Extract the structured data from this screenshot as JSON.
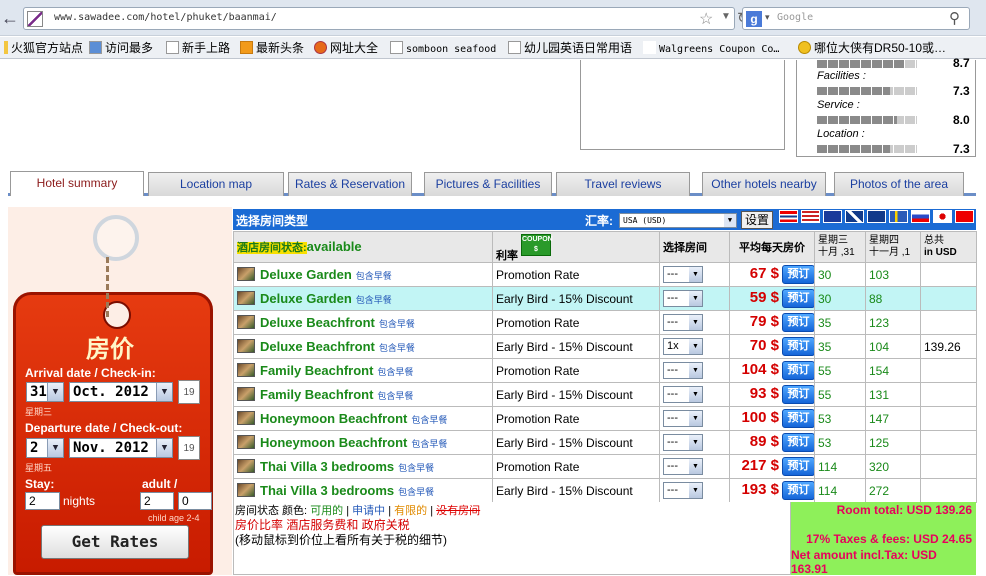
{
  "browser": {
    "url": "www.sawadee.com/hotel/phuket/baanmai/",
    "search_placeholder": "Google",
    "bookmarks": [
      "火狐官方站点",
      "访问最多",
      "新手上路",
      "最新头条",
      "网址大全",
      "somboon seafood",
      "幼儿园英语日常用语",
      "Walgreens Coupon Co…",
      "哪位大侠有DR50-10或…"
    ]
  },
  "ratings": [
    {
      "label": "",
      "value": "8.7",
      "fill": 0.87
    },
    {
      "label": "Facilities :",
      "value": "7.3",
      "fill": 0.73
    },
    {
      "label": "Service :",
      "value": "8.0",
      "fill": 0.8
    },
    {
      "label": "Location :",
      "value": "7.3",
      "fill": 0.73
    }
  ],
  "tabs": [
    "Hotel summary",
    "Location map",
    "Rates & Reservation",
    "Pictures & Facilities",
    "Travel reviews",
    "Other hotels nearby",
    "Photos of the area"
  ],
  "left": {
    "title": "房价",
    "arrival_label": "Arrival date / Check-in:",
    "arrival_day": "31",
    "arrival_month": "Oct.  2012",
    "arrival_weekday": "星期三",
    "departure_label": "Departure date / Check-out:",
    "departure_day": "2",
    "departure_month": "Nov.  2012",
    "departure_weekday": "星期五",
    "calendar_icon_text": "19",
    "stay_label": "Stay:",
    "stay_value": "2",
    "nights_label": "nights",
    "adult_child_label": "adult / child:",
    "adult_value": "2",
    "child_value": "0",
    "child_age": "child age 2-4",
    "get_rates": "Get Rates"
  },
  "table_header": {
    "title": "选择房间类型",
    "currency_label": "汇率:",
    "currency_value": "USA (USD)",
    "set_button": "设置",
    "status_label": "酒店房间状态:",
    "status_value": "available",
    "rate_col": "利率",
    "coupon": "COUPON",
    "coupon_sub": "$",
    "select_col": "选择房间",
    "avg_col": "平均每天房价",
    "d1": "星期三",
    "d1b": "十月 ,31",
    "d2": "星期四",
    "d2b": "十一月 ,1",
    "total": "总共",
    "total_b": "in USD"
  },
  "rooms": [
    {
      "name": "Deluxe Garden",
      "incl": "包含早餐",
      "rate": "Promotion Rate",
      "qty": "---",
      "price": "67 $",
      "n1": "30",
      "n2": "103",
      "total": "",
      "hl": false
    },
    {
      "name": "Deluxe Garden",
      "incl": "包含早餐",
      "rate": "Early Bird - 15% Discount",
      "qty": "---",
      "price": "59 $",
      "n1": "30",
      "n2": "88",
      "total": "",
      "hl": true
    },
    {
      "name": "Deluxe Beachfront",
      "incl": "包含早餐",
      "rate": "Promotion Rate",
      "qty": "---",
      "price": "79 $",
      "n1": "35",
      "n2": "123",
      "total": "",
      "hl": false
    },
    {
      "name": "Deluxe Beachfront",
      "incl": "包含早餐",
      "rate": "Early Bird - 15% Discount",
      "qty": "1x",
      "price": "70 $",
      "n1": "35",
      "n2": "104",
      "total": "139.26",
      "hl": false
    },
    {
      "name": "Family Beachfront",
      "incl": "包含早餐",
      "rate": "Promotion Rate",
      "qty": "---",
      "price": "104 $",
      "n1": "55",
      "n2": "154",
      "total": "",
      "hl": false
    },
    {
      "name": "Family Beachfront",
      "incl": "包含早餐",
      "rate": "Early Bird - 15% Discount",
      "qty": "---",
      "price": "93 $",
      "n1": "55",
      "n2": "131",
      "total": "",
      "hl": false
    },
    {
      "name": "Honeymoon Beachfront",
      "incl": "包含早餐",
      "rate": "Promotion Rate",
      "qty": "---",
      "price": "100 $",
      "n1": "53",
      "n2": "147",
      "total": "",
      "hl": false
    },
    {
      "name": "Honeymoon Beachfront",
      "incl": "包含早餐",
      "rate": "Early Bird - 15% Discount",
      "qty": "---",
      "price": "89 $",
      "n1": "53",
      "n2": "125",
      "total": "",
      "hl": false
    },
    {
      "name": "Thai Villa 3 bedrooms",
      "incl": "包含早餐",
      "rate": "Promotion Rate",
      "qty": "---",
      "price": "217 $",
      "n1": "114",
      "n2": "320",
      "total": "",
      "hl": false
    },
    {
      "name": "Thai Villa 3 bedrooms",
      "incl": "包含早餐",
      "rate": "Early Bird - 15% Discount",
      "qty": "---",
      "price": "193 $",
      "n1": "114",
      "n2": "272",
      "total": "",
      "hl": false
    }
  ],
  "book_label": "预订",
  "legend": {
    "prefix": "房间状态 颜色:",
    "available": "可用的",
    "request": "申请中",
    "limited": "有限的",
    "none": "没有房间",
    "line2": "房价比率 酒店服务费和 政府关税",
    "line3": "(移动鼠标到价位上看所有关于税的细节)"
  },
  "summary": {
    "room_total": "Room total: USD 139.26",
    "taxes": "17% Taxes & fees: USD 24.65",
    "net": "Net amount incl.Tax: USD 163.91"
  },
  "colors": {
    "accent": "#1b6bd4",
    "price": "#d40000",
    "room_name": "#1a8a1a",
    "summary_bg": "#8ef05a"
  }
}
